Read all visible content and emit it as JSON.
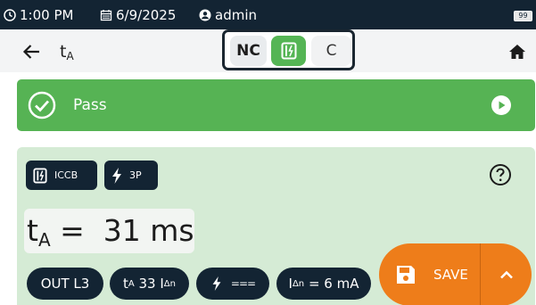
{
  "status_bar": {
    "time": "1:00 PM",
    "date": "6/9/2025",
    "user": "admin",
    "battery": "99"
  },
  "header": {
    "title_main": "t",
    "title_sub": "A",
    "mode_options": [
      "NC",
      "breaker-icon",
      "C"
    ],
    "selected_mode": "breaker-icon"
  },
  "result": {
    "status": "Pass"
  },
  "chips": {
    "device": "ICCB",
    "poles": "3P"
  },
  "measurement": {
    "symbol": "t",
    "symbol_sub": "A",
    "equals": "=",
    "value": "31 ms"
  },
  "params": {
    "output": "OUT L3",
    "test_main": "t",
    "test_sub": "A",
    "test_value": "33 I",
    "test_value_sub": "Δn",
    "waveform": "===",
    "idn_main": "I",
    "idn_sub": "Δn",
    "idn_value": "= 6 mA"
  },
  "save": {
    "label": "SAVE"
  },
  "colors": {
    "status_bar": "#132433",
    "pass_green": "#56b354",
    "panel_green": "#d5ebd5",
    "accent_orange": "#ee7d1a",
    "chip_dark": "#132433"
  }
}
